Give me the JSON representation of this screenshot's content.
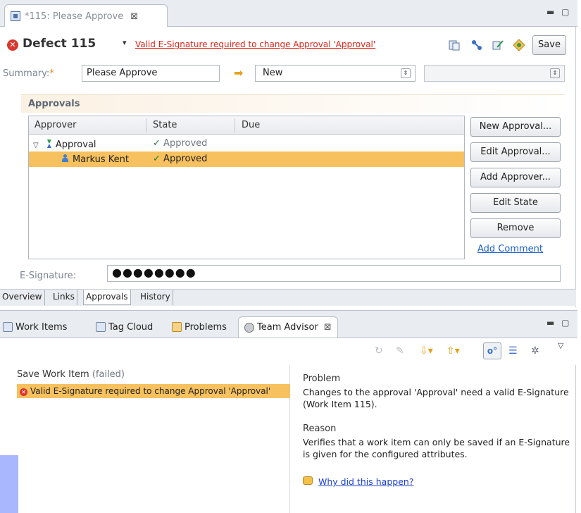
{
  "editor": {
    "tab_title": "*115: Please Approve",
    "tab_close": "⊠",
    "minmax": "▬ ▢",
    "work_item": "Defect 115",
    "menu_arrow": "▾",
    "error_message": "Valid E-Signature required to change Approval 'Approval'",
    "save_label": "Save",
    "summary_label": "Summary:",
    "summary_required": "*",
    "summary_value": "Please Approve",
    "state_value": "New",
    "icons": [
      "history-icon",
      "links-icon",
      "edit-icon",
      "plugin-icon"
    ]
  },
  "approvals": {
    "section_title": "Approvals",
    "columns": [
      "Approver",
      "State",
      "Due"
    ],
    "rows": [
      {
        "approver": "Approval",
        "state": "Approved",
        "due": ""
      },
      {
        "approver": "Markus Kent",
        "state": "Approved",
        "due": ""
      }
    ],
    "buttons": [
      "New Approval...",
      "Edit Approval...",
      "Add Approver...",
      "Edit State",
      "Remove"
    ],
    "add_comment": "Add Comment",
    "esig_label": "E-Signature:",
    "esig_value": "●●●●●●●●"
  },
  "page_tabs": [
    "Overview",
    "Links",
    "Approvals",
    "History"
  ],
  "views": {
    "tabs": [
      "Work Items",
      "Tag Cloud",
      "Problems",
      "Team Advisor"
    ],
    "tab_close": "⊠",
    "minmax": "▬ ▢"
  },
  "advisor": {
    "results_title": "Save Work Item",
    "results_status": "(failed)",
    "result_item": "Valid E-Signature required to change Approval 'Approval'",
    "problem_heading": "Problem",
    "problem_text": "Changes to the approval 'Approval' need a valid E-Signature (Work Item 115).",
    "reason_heading": "Reason",
    "reason_text": "Verifies that a work item can only be saved if an E-Signature is given for the configured attributes.",
    "why_link": "Why did this happen?"
  },
  "colors": {
    "selection": "#f6c15e",
    "error": "#e2231a",
    "link": "#1a5fd0",
    "approved": "#1f7a2e"
  }
}
